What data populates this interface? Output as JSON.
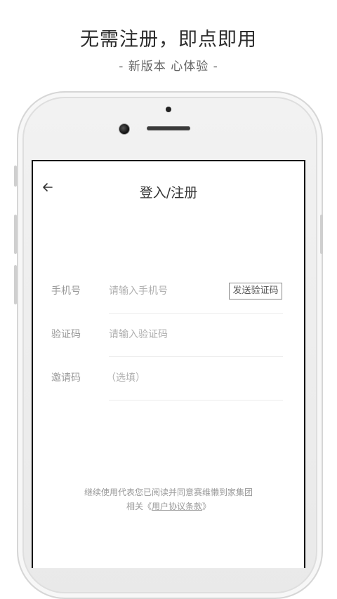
{
  "promo": {
    "headline": "无需注册，即点即用",
    "subline": "- 新版本 心体验 -"
  },
  "screen": {
    "title": "登入/注册",
    "back_icon": "arrow-left-icon"
  },
  "form": {
    "phone": {
      "label": "手机号",
      "placeholder": "请输入手机号",
      "value": ""
    },
    "send_code_label": "发送验证码",
    "code": {
      "label": "验证码",
      "placeholder": "请输入验证码",
      "value": ""
    },
    "invite": {
      "label": "邀请码",
      "placeholder": "（选填）",
      "value": ""
    }
  },
  "agreement": {
    "line1": "继续使用代表您已阅读并同意赛维懒到家集团",
    "line2_prefix": "相关《",
    "link_text": "用户协议条款",
    "line2_suffix": "》"
  }
}
